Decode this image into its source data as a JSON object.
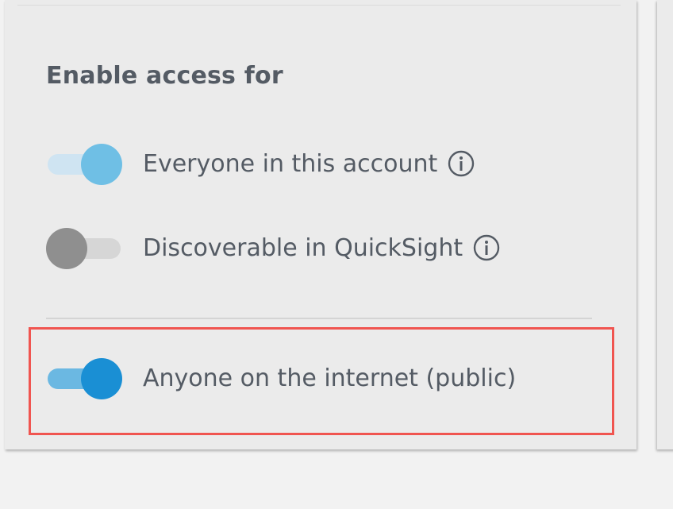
{
  "section": {
    "heading": "Enable access for"
  },
  "options": [
    {
      "label": "Everyone in this account",
      "enabled": true,
      "has_info": true,
      "info_icon": "info-circle-icon",
      "track_color": "#cfe4f2",
      "knob_color": "#6fbfe5"
    },
    {
      "label": "Discoverable in QuickSight",
      "enabled": false,
      "has_info": true,
      "info_icon": "info-circle-icon",
      "track_color": "#d6d6d6",
      "knob_color": "#8f8f8f"
    },
    {
      "label": "Anyone on the internet (public)",
      "enabled": true,
      "highlighted": true,
      "track_color": "#6bb8e2",
      "knob_color": "#1a8fd4"
    }
  ],
  "colors": {
    "highlight_border": "#f05550",
    "panel_background": "#ebebeb",
    "page_background": "#f2f2f2",
    "text": "#545b64"
  }
}
